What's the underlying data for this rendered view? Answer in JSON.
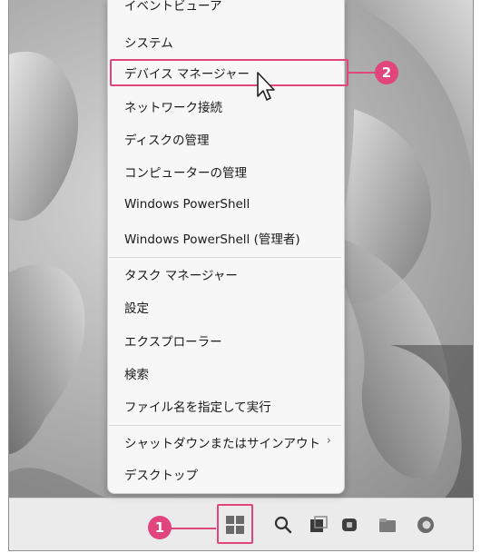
{
  "menu": {
    "items": [
      {
        "label": "イベントビューア",
        "chevron": false
      },
      {
        "label": "システム",
        "chevron": false
      },
      {
        "label": "デバイス マネージャー",
        "chevron": false
      },
      {
        "label": "ネットワーク接続",
        "chevron": false
      },
      {
        "label": "ディスクの管理",
        "chevron": false
      },
      {
        "label": "コンピューターの管理",
        "chevron": false
      },
      {
        "label": "Windows PowerShell",
        "chevron": false
      },
      {
        "label": "Windows PowerShell (管理者)",
        "chevron": false
      },
      {
        "label": "タスク マネージャー",
        "chevron": false
      },
      {
        "label": "設定",
        "chevron": false
      },
      {
        "label": "エクスプローラー",
        "chevron": false
      },
      {
        "label": "検索",
        "chevron": false
      },
      {
        "label": "ファイル名を指定して実行",
        "chevron": false
      },
      {
        "label": "シャットダウンまたはサインアウト",
        "chevron": true,
        "chevron_glyph": "›"
      },
      {
        "label": "デスクトップ",
        "chevron": false
      }
    ]
  },
  "callouts": {
    "start": "1",
    "device_manager": "2"
  },
  "taskbar": {
    "icons": [
      "start-icon",
      "search-icon",
      "task-view-icon",
      "chat-icon",
      "file-explorer-icon",
      "browser-icon"
    ]
  },
  "colors": {
    "accent": "#e0457b",
    "menu_bg": "#f7f7f7",
    "taskbar_bg": "#ebebeb"
  }
}
